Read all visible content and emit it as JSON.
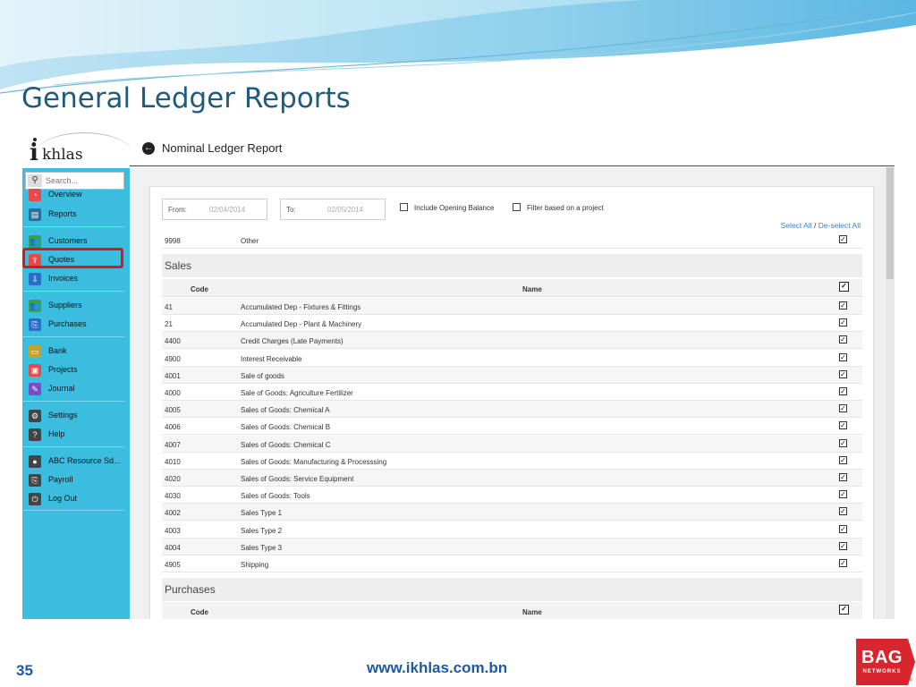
{
  "slide": {
    "title": "General Ledger Reports",
    "number": "35",
    "url": "www.ikhlas.com.bn",
    "logo_text": "BAG",
    "logo_subtext": "NETWORKS",
    "logo_reg": "®"
  },
  "app": {
    "logo_text": "khlas",
    "logo_i": "i",
    "page_title": "Nominal Ledger Report",
    "search_placeholder": "Search...",
    "nav": [
      {
        "label": "Overview",
        "icon": "gauge-icon",
        "color": "#e8474c"
      },
      {
        "label": "Reports",
        "icon": "report-icon",
        "color": "#2a6e9e"
      },
      {
        "label": "Customers",
        "icon": "customers-icon",
        "color": "#3aa04a"
      },
      {
        "label": "Quotes",
        "icon": "quotes-icon",
        "color": "#e8474c"
      },
      {
        "label": "Invoices",
        "icon": "invoices-icon",
        "color": "#2a6ec9"
      },
      {
        "label": "Suppliers",
        "icon": "suppliers-icon",
        "color": "#3aa04a"
      },
      {
        "label": "Purchases",
        "icon": "purchases-icon",
        "color": "#2a6ec9"
      },
      {
        "label": "Bank",
        "icon": "bank-icon",
        "color": "#c4a12a"
      },
      {
        "label": "Projects",
        "icon": "projects-icon",
        "color": "#e8474c"
      },
      {
        "label": "Journal",
        "icon": "journal-icon",
        "color": "#7a4cc9"
      },
      {
        "label": "Settings",
        "icon": "gear-icon",
        "color": "#444444"
      },
      {
        "label": "Help",
        "icon": "help-icon",
        "color": "#444444"
      },
      {
        "label": "ABC Resource Sd...",
        "icon": "user-icon",
        "color": "#444444"
      },
      {
        "label": "Payroll",
        "icon": "payroll-icon",
        "color": "#444444"
      },
      {
        "label": "Log Out",
        "icon": "power-icon",
        "color": "#444444"
      }
    ],
    "filters": {
      "from_label": "From:",
      "from_value": "02/04/2014",
      "to_label": "To:",
      "to_value": "02/05/2014",
      "opening_balance_label": "Include Opening Balance",
      "project_filter_label": "Filter based on a project",
      "select_all": "Select All",
      "separator": "/",
      "deselect_all": "De-select All"
    },
    "top_row": {
      "code": "9998",
      "name": "Other"
    },
    "sales": {
      "title": "Sales",
      "col_code": "Code",
      "col_name": "Name",
      "rows": [
        {
          "code": "41",
          "name": "Accumulated Dep - Fixtures & Fittings"
        },
        {
          "code": "21",
          "name": "Accumulated Dep - Plant & Machinery"
        },
        {
          "code": "4400",
          "name": "Credit Charges (Late Payments)"
        },
        {
          "code": "4900",
          "name": "Interest Receivable"
        },
        {
          "code": "4001",
          "name": "Sale of goods"
        },
        {
          "code": "4000",
          "name": "Sale of Goods: Agriculture Fertilizer"
        },
        {
          "code": "4005",
          "name": "Sales of Goods: Chemical A"
        },
        {
          "code": "4006",
          "name": "Sales of Goods: Chemical B"
        },
        {
          "code": "4007",
          "name": "Sales of Goods: Chemical C"
        },
        {
          "code": "4010",
          "name": "Sales of Goods: Manufacturing & Processsing"
        },
        {
          "code": "4020",
          "name": "Sales of Goods: Service Equipment"
        },
        {
          "code": "4030",
          "name": "Sales of Goods: Tools"
        },
        {
          "code": "4002",
          "name": "Sales Type 1"
        },
        {
          "code": "4003",
          "name": "Sales Type 2"
        },
        {
          "code": "4004",
          "name": "Sales Type 3"
        },
        {
          "code": "4905",
          "name": "Shipping"
        }
      ]
    },
    "purchases": {
      "title": "Purchases",
      "col_code": "Code",
      "col_name": "Name"
    },
    "check_glyph": "✓"
  }
}
